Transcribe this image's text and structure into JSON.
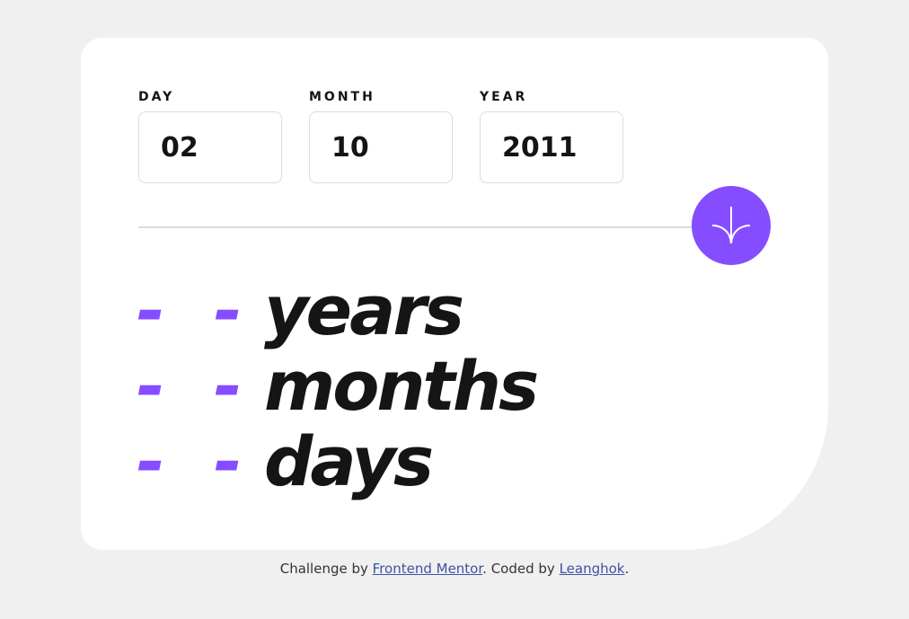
{
  "colors": {
    "background": "#f0f0f0",
    "card": "#ffffff",
    "accent": "#854dff",
    "text": "#151515",
    "border": "#dcdcdc",
    "link": "#3e52a3"
  },
  "form": {
    "day": {
      "label": "DAY",
      "value": "02"
    },
    "month": {
      "label": "MONTH",
      "value": "10"
    },
    "year": {
      "label": "YEAR",
      "value": "2011"
    },
    "submit_icon": "arrow-down-icon"
  },
  "results": {
    "years": {
      "value": "- -",
      "unit": "years"
    },
    "months": {
      "value": "- -",
      "unit": "months"
    },
    "days": {
      "value": "- -",
      "unit": "days"
    }
  },
  "attribution": {
    "prefix": "Challenge by ",
    "link1": "Frontend Mentor",
    "middle": ". Coded by ",
    "link2": "Leanghok",
    "suffix": "."
  }
}
